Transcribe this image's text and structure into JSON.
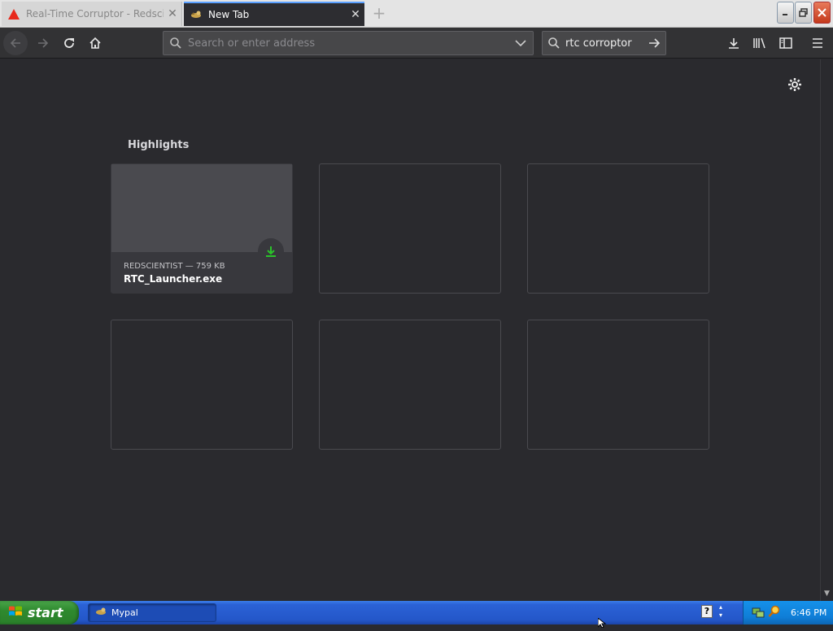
{
  "tabs": [
    {
      "title": "Real-Time Corruptor - Redscientis",
      "favicon": "warning-triangle-icon",
      "active": false
    },
    {
      "title": "New Tab",
      "favicon": "mypal-icon",
      "active": true
    }
  ],
  "toolbar": {
    "url_placeholder": "Search or enter address",
    "url_value": "",
    "search_text": "rtc corroptor"
  },
  "content": {
    "highlights_title": "Highlights",
    "highlight_items": [
      {
        "meta": "REDSCIENTIST — 759 KB",
        "name": "RTC_Launcher.exe",
        "type": "download"
      }
    ]
  },
  "taskbar": {
    "start_label": "start",
    "tasks": [
      {
        "label": "Mypal"
      }
    ],
    "help_label": "?",
    "clock": "6:46 PM"
  },
  "colors": {
    "page_bg": "#2a2a2e",
    "toolbar_bg": "#323234",
    "accent_download": "#2ac32a",
    "taskbar_blue": "#2457c9",
    "start_green": "#2f8a2f"
  }
}
